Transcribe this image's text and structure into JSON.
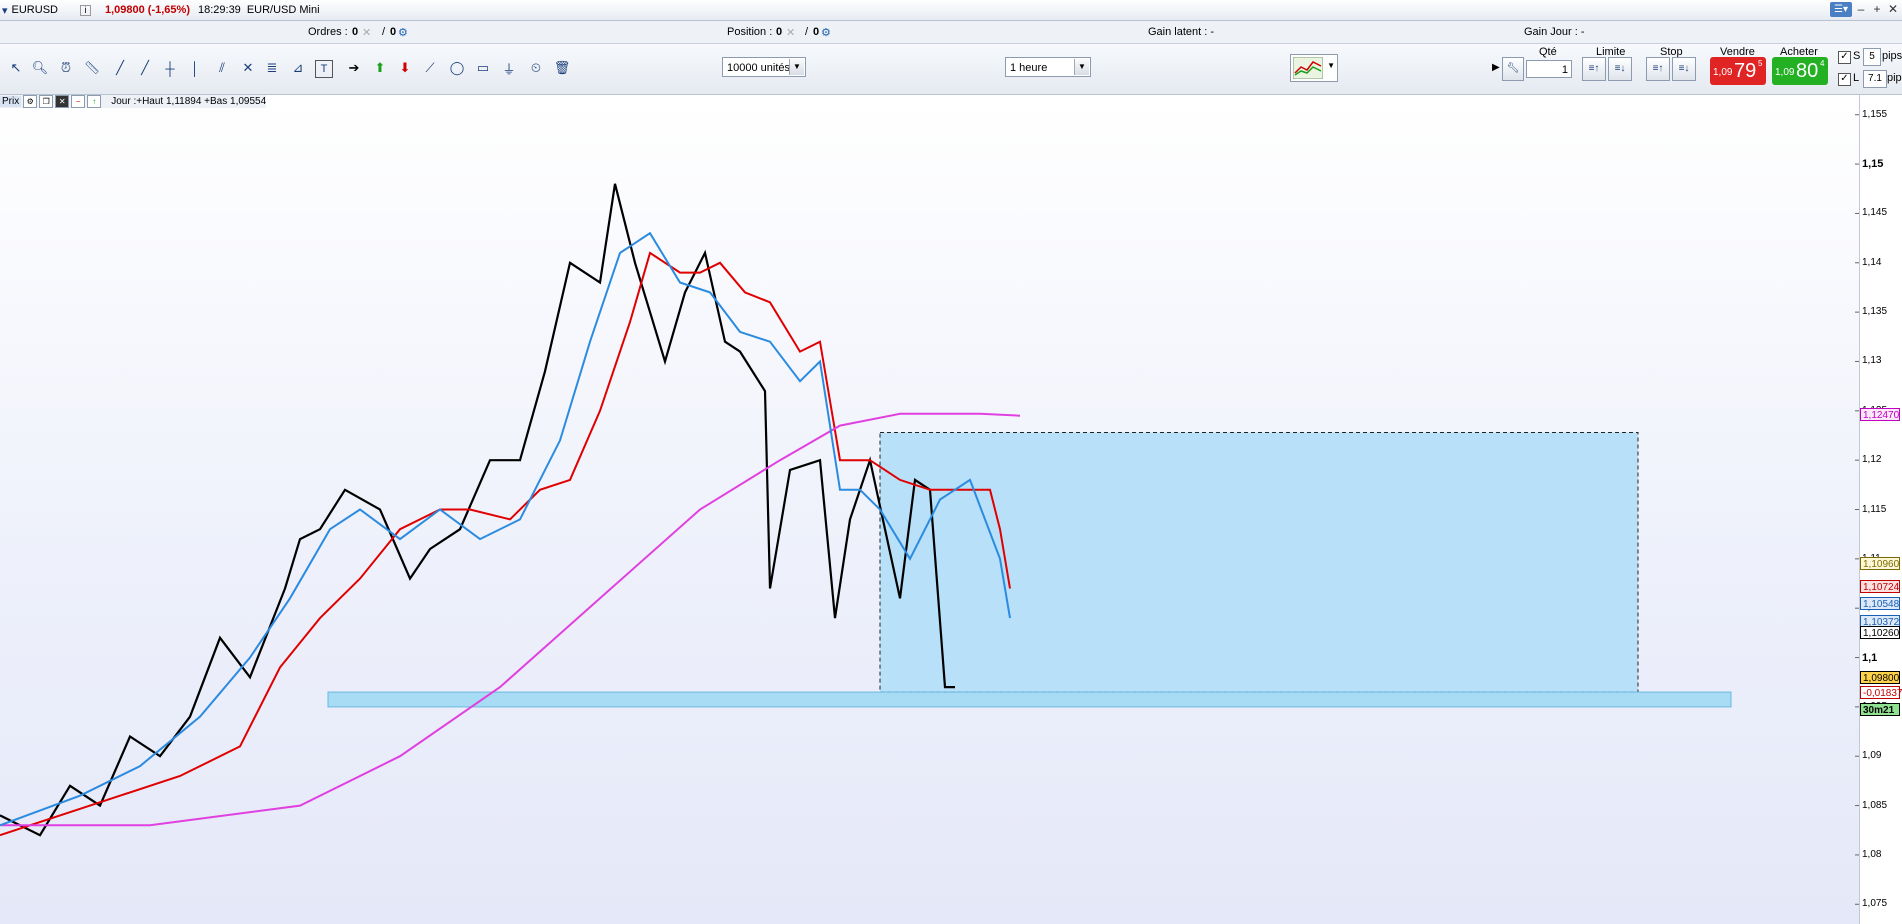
{
  "title_bar": {
    "symbol": "EURUSD",
    "price_change": "1,09800 (-1,65%)",
    "time": "18:29:39",
    "instrument": "EUR/USD Mini"
  },
  "info_bar": {
    "orders_label": "Ordres :",
    "orders_value": "0",
    "orders_value2": "0",
    "position_label": "Position :",
    "position_value": "0",
    "position_value2": "0",
    "unrealized_label": "Gain latent : -",
    "daily_gain_label": "Gain Jour : -"
  },
  "toolbar": {
    "units_select": "10000 unités",
    "timeframe_select": "1 heure"
  },
  "trade_panel": {
    "qty_label": "Qté",
    "qty_value": "1",
    "limit_label": "Limite",
    "stop_label": "Stop",
    "sell_label": "Vendre",
    "buy_label": "Acheter",
    "sell_small": "1,09",
    "sell_big": "79",
    "sell_sup": "5",
    "buy_small": "1,09",
    "buy_big": "80",
    "buy_sup": "4",
    "s_label": "S",
    "s_value": "5",
    "l_label": "L",
    "l_value": "7.1",
    "pips_label": "pips"
  },
  "chart_header": {
    "price_label": "Prix",
    "day_info": "Jour :+Haut 1,11894 +Bas 1,09554"
  },
  "chart_data": {
    "type": "line",
    "price_axis_ticks": [
      "1,155",
      "1,15",
      "1,145",
      "1,14",
      "1,135",
      "1,13",
      "1,125",
      "1,12",
      "1,115",
      "1,11",
      "1,105",
      "1,1",
      "1,095",
      "1,09",
      "1,085",
      "1,08",
      "1,075"
    ],
    "y_range": [
      1.073,
      1.157
    ],
    "price_tags": [
      {
        "text": "1,12470",
        "color": "#c000c0",
        "bg": "#fbe8fb",
        "value": 1.1247
      },
      {
        "text": "1,10960",
        "color": "#7a6b00",
        "bg": "#fdf7d8",
        "value": 1.1096
      },
      {
        "text": "1,10724",
        "color": "#c00000",
        "bg": "#fde0e0",
        "value": 1.10724
      },
      {
        "text": "1,10548",
        "color": "#1a5fb4",
        "bg": "#dde9f8",
        "value": 1.10548
      },
      {
        "text": "1,10372",
        "color": "#1a5fb4",
        "bg": "#dde9f8",
        "value": 1.10372
      },
      {
        "text": "1,10260",
        "color": "#000000",
        "bg": "#ffffff",
        "value": 1.1026
      },
      {
        "text": "1,09800",
        "color": "#000000",
        "bg": "#ffd24a",
        "value": 1.098
      },
      {
        "text": "-0,01837",
        "color": "#c00000",
        "bg": "#ffffff",
        "value": 1.0965
      },
      {
        "text": "30m21",
        "color": "#000000",
        "bg": "#8fe08f",
        "value": 1.0948
      }
    ],
    "series": [
      {
        "name": "",
        "color": "#000000",
        "values": [
          [
            0,
            1.084
          ],
          [
            40,
            1.082
          ],
          [
            70,
            1.087
          ],
          [
            100,
            1.085
          ],
          [
            130,
            1.092
          ],
          [
            160,
            1.09
          ],
          [
            190,
            1.094
          ],
          [
            220,
            1.102
          ],
          [
            250,
            1.098
          ],
          [
            285,
            1.107
          ],
          [
            300,
            1.112
          ],
          [
            320,
            1.113
          ],
          [
            345,
            1.117
          ],
          [
            380,
            1.115
          ],
          [
            410,
            1.108
          ],
          [
            430,
            1.111
          ],
          [
            460,
            1.113
          ],
          [
            490,
            1.12
          ],
          [
            520,
            1.12
          ],
          [
            545,
            1.129
          ],
          [
            570,
            1.14
          ],
          [
            600,
            1.138
          ],
          [
            615,
            1.148
          ],
          [
            635,
            1.14
          ],
          [
            650,
            1.135
          ],
          [
            665,
            1.13
          ],
          [
            685,
            1.137
          ],
          [
            705,
            1.141
          ],
          [
            725,
            1.132
          ],
          [
            740,
            1.131
          ],
          [
            765,
            1.127
          ],
          [
            770,
            1.107
          ],
          [
            790,
            1.119
          ],
          [
            820,
            1.12
          ],
          [
            835,
            1.104
          ],
          [
            850,
            1.114
          ],
          [
            870,
            1.12
          ],
          [
            900,
            1.106
          ],
          [
            915,
            1.118
          ],
          [
            930,
            1.117
          ],
          [
            945,
            1.097
          ],
          [
            955,
            1.097
          ]
        ]
      },
      {
        "name": "",
        "color": "#e00000",
        "values": [
          [
            0,
            1.082
          ],
          [
            60,
            1.084
          ],
          [
            120,
            1.086
          ],
          [
            180,
            1.088
          ],
          [
            240,
            1.091
          ],
          [
            280,
            1.099
          ],
          [
            320,
            1.104
          ],
          [
            360,
            1.108
          ],
          [
            400,
            1.113
          ],
          [
            440,
            1.115
          ],
          [
            470,
            1.115
          ],
          [
            510,
            1.114
          ],
          [
            540,
            1.117
          ],
          [
            570,
            1.118
          ],
          [
            600,
            1.125
          ],
          [
            630,
            1.134
          ],
          [
            650,
            1.141
          ],
          [
            680,
            1.139
          ],
          [
            700,
            1.139
          ],
          [
            720,
            1.14
          ],
          [
            745,
            1.137
          ],
          [
            770,
            1.136
          ],
          [
            800,
            1.131
          ],
          [
            820,
            1.132
          ],
          [
            840,
            1.12
          ],
          [
            870,
            1.12
          ],
          [
            900,
            1.118
          ],
          [
            930,
            1.117
          ],
          [
            960,
            1.117
          ],
          [
            990,
            1.117
          ],
          [
            1000,
            1.113
          ],
          [
            1010,
            1.107
          ]
        ]
      },
      {
        "name": "",
        "color": "#e040e0",
        "values": [
          [
            0,
            1.083
          ],
          [
            150,
            1.083
          ],
          [
            300,
            1.085
          ],
          [
            400,
            1.09
          ],
          [
            500,
            1.097
          ],
          [
            600,
            1.106
          ],
          [
            700,
            1.115
          ],
          [
            780,
            1.12
          ],
          [
            840,
            1.1235
          ],
          [
            900,
            1.1247
          ],
          [
            980,
            1.1247
          ],
          [
            1020,
            1.1245
          ]
        ]
      },
      {
        "name": "",
        "color": "#2b8be0",
        "values": [
          [
            0,
            1.083
          ],
          [
            80,
            1.086
          ],
          [
            140,
            1.089
          ],
          [
            200,
            1.094
          ],
          [
            250,
            1.1
          ],
          [
            290,
            1.106
          ],
          [
            330,
            1.113
          ],
          [
            360,
            1.115
          ],
          [
            400,
            1.112
          ],
          [
            440,
            1.115
          ],
          [
            480,
            1.112
          ],
          [
            520,
            1.114
          ],
          [
            560,
            1.122
          ],
          [
            590,
            1.132
          ],
          [
            620,
            1.141
          ],
          [
            650,
            1.143
          ],
          [
            680,
            1.138
          ],
          [
            710,
            1.137
          ],
          [
            740,
            1.133
          ],
          [
            770,
            1.132
          ],
          [
            800,
            1.128
          ],
          [
            820,
            1.13
          ],
          [
            840,
            1.117
          ],
          [
            860,
            1.117
          ],
          [
            880,
            1.115
          ],
          [
            910,
            1.11
          ],
          [
            940,
            1.116
          ],
          [
            970,
            1.118
          ],
          [
            1000,
            1.11
          ],
          [
            1010,
            1.104
          ]
        ]
      }
    ],
    "ichimoku_cloud": [
      {
        "x": 270,
        "top": 1.0965,
        "bottom": 1.0955
      },
      {
        "x": 300,
        "top": 1.095,
        "bottom": 1.0935
      }
    ]
  }
}
